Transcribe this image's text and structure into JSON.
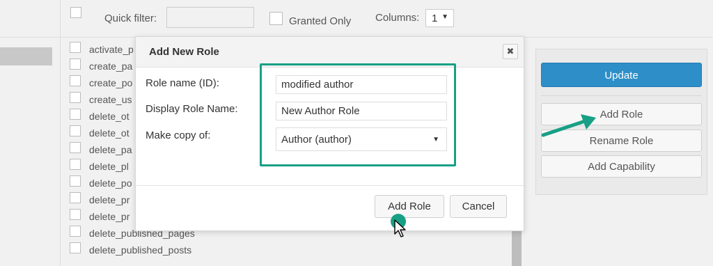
{
  "toolbar": {
    "quick_filter_label": "Quick filter:",
    "quick_filter_value": "",
    "granted_only_label": "Granted Only",
    "columns_label": "Columns:",
    "columns_value": "1"
  },
  "capabilities": [
    "activate_p",
    "create_pa",
    "create_po",
    "create_us",
    "delete_ot",
    "delete_ot",
    "delete_pa",
    "delete_pl",
    "delete_po",
    "delete_pr",
    "delete_pr",
    "delete_published_pages",
    "delete_published_posts"
  ],
  "side_panel": {
    "update_label": "Update",
    "add_role_label": "Add Role",
    "rename_role_label": "Rename Role",
    "add_capability_label": "Add Capability"
  },
  "dialog": {
    "title": "Add New Role",
    "close_glyph": "✖",
    "role_name_label": "Role name (ID):",
    "role_name_value": "modified author",
    "display_name_label": "Display Role Name:",
    "display_name_value": "New Author Role",
    "copy_label": "Make copy of:",
    "copy_value": "Author (author)",
    "add_role_button": "Add Role",
    "cancel_button": "Cancel"
  },
  "colors": {
    "accent_highlight": "#17a085",
    "update_button": "#2e8fc8"
  }
}
